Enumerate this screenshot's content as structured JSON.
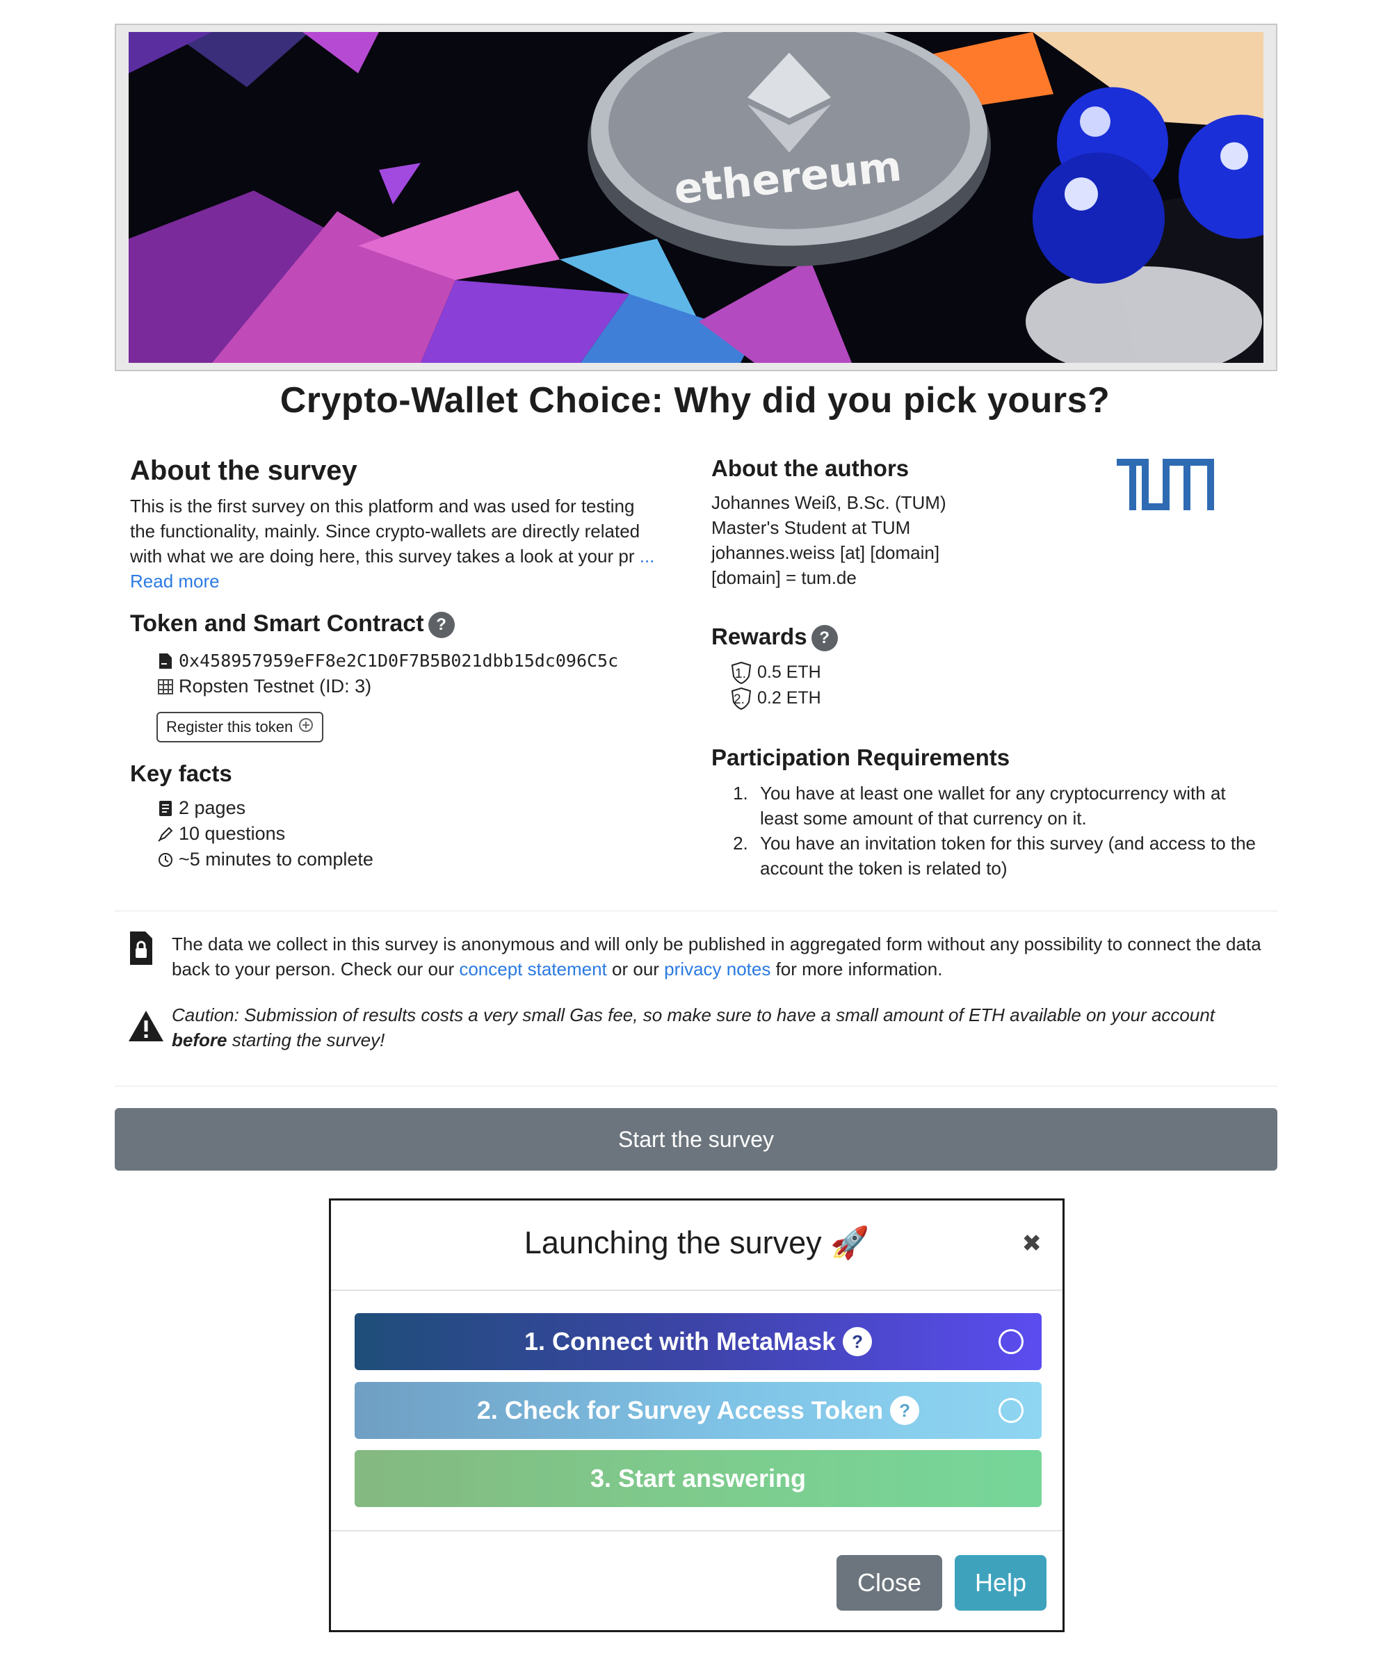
{
  "banner": {
    "alt": "ethereum coin banner",
    "coin_text": "ethereum"
  },
  "title": "Crypto-Wallet Choice: Why did you pick yours?",
  "about_survey": {
    "heading": "About the survey",
    "text_line1": "This is the first survey on this platform and was used for testing",
    "text_line2": "the functionality, mainly. Since crypto-wallets are directly related",
    "text_line3": "with what we are doing here, this survey takes a look at your pr",
    "ellipsis": "...",
    "read_more": "Read more"
  },
  "token": {
    "heading": "Token and Smart Contract",
    "help": "?",
    "address": "0x458957959eFF8e2C1D0F7B5B021dbb15dc096C5c",
    "network": "Ropsten Testnet (ID: 3)",
    "register_label": "Register this token"
  },
  "key_facts": {
    "heading": "Key facts",
    "pages": "2 pages",
    "questions": "10 questions",
    "duration": "~5 minutes to complete"
  },
  "authors": {
    "heading": "About the authors",
    "name": "Johannes Weiß, B.Sc. (TUM)",
    "role": "Master's Student at TUM",
    "email": "johannes.weiss [at] [domain]",
    "domain": "[domain] = tum.de",
    "logo_text": "TUM"
  },
  "rewards": {
    "heading": "Rewards",
    "help": "?",
    "items": [
      {
        "rank": "1.",
        "amount": "0.5 ETH"
      },
      {
        "rank": "2.",
        "amount": "0.2 ETH"
      }
    ]
  },
  "requirements": {
    "heading": "Participation Requirements",
    "items": [
      "You have at least one wallet for any cryptocurrency with at least some amount of that currency on it.",
      "You have an invitation token for this survey (and access to the account the token is related to)"
    ]
  },
  "privacy": {
    "text_before": "The data we collect in this survey is anonymous and will only be published in aggregated form without any possibility to connect the data back to your person. Check our our ",
    "link1": "concept statement",
    "text_mid": " or our ",
    "link2": "privacy notes",
    "text_after": " for more information."
  },
  "caution": {
    "text_before": "Caution: Submission of results costs a very small Gas fee, so make sure to have a small amount of ETH available on your account ",
    "bold": "before",
    "text_after": " starting the survey!"
  },
  "start_button": "Start the survey",
  "modal": {
    "title": "Launching the survey",
    "emoji": "🚀",
    "close_x": "✖",
    "step1": "1. Connect with MetaMask",
    "step2": "2. Check for Survey Access Token",
    "step3": "3. Start answering",
    "help_q": "?",
    "close_label": "Close",
    "help_label": "Help"
  },
  "colors": {
    "link": "#2a7ae2",
    "secondary": "#6c757d",
    "info": "#3ea2bd"
  }
}
